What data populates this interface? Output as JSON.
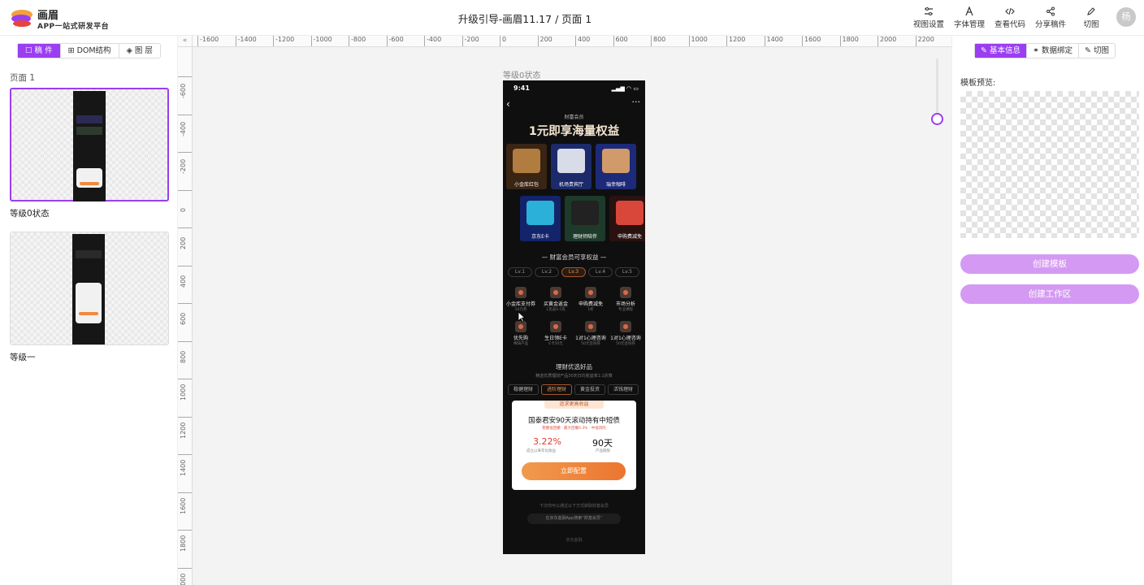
{
  "app": {
    "brand_name": "画眉",
    "brand_sub": "APP一站式研发平台",
    "doc_title": "升级引导-画眉11.17 / 页面 1",
    "avatar_text": "杨"
  },
  "toolbar": {
    "view_settings": "视图设置",
    "font_manage": "字体管理",
    "view_code": "查看代码",
    "share": "分享稿件",
    "slice": "切图"
  },
  "left_panel": {
    "tabs": [
      "稿 件",
      "DOM结构",
      "图 层"
    ],
    "active_tab": 0,
    "page_label": "页面 1",
    "frames": [
      {
        "name": "等级0状态",
        "selected": true
      },
      {
        "name": "等级一",
        "selected": false
      }
    ]
  },
  "canvas": {
    "ruler_h": [
      "-1600",
      "-1400",
      "-1200",
      "-1000",
      "-800",
      "-600",
      "-400",
      "-200",
      "0",
      "200",
      "400",
      "600",
      "800",
      "1000",
      "1200",
      "1400",
      "1600",
      "1800",
      "2000",
      "2200"
    ],
    "ruler_v": [
      "-600",
      "-400",
      "-200",
      "0",
      "200",
      "400",
      "600",
      "800",
      "1000",
      "1200",
      "1400",
      "1600",
      "1800",
      "2000"
    ],
    "frame_label": "等级0状态"
  },
  "phone": {
    "time": "9:41",
    "club_logo": "财富会员",
    "headline": "1元即享海量权益",
    "row1": [
      {
        "label": "小金库红包",
        "color": "#3a2414",
        "pic": "#b07c40"
      },
      {
        "label": "机场贵宾厅",
        "color": "#1c2a6b",
        "pic": "#d8dce8"
      },
      {
        "label": "瑞幸咖啡",
        "color": "#1d2a7a",
        "pic": "#d19a6b"
      }
    ],
    "row2": [
      {
        "label": "京东E卡",
        "color": "#13246b",
        "pic": "#2bb1d9"
      },
      {
        "label": "理财师陪伴",
        "color": "#1d3a2a",
        "pic": "#222"
      },
      {
        "label": "申购费减免",
        "color": "#2a1210",
        "pic": "#d8473a"
      }
    ],
    "benefits_title": "财富会员可享权益",
    "levels": [
      "Lv.1",
      "Lv.2",
      "Lv.3",
      "Lv.4",
      "Lv.5"
    ],
    "active_level": 2,
    "benefits": [
      {
        "name": "小金库支付券",
        "sub": "10元券"
      },
      {
        "name": "买黄金返金",
        "sub": "1克返0.5克"
      },
      {
        "name": "申购费减免",
        "sub": "1折"
      },
      {
        "name": "市场分析",
        "sub": "专业课程"
      },
      {
        "name": "优先购",
        "sub": "稀缺产品"
      },
      {
        "name": "生日领E卡",
        "sub": "E卡50元"
      },
      {
        "name": "1对1心理咨询",
        "sub": "50元咨询券"
      },
      {
        "name": "1对1心理咨询",
        "sub": "50元咨询券"
      }
    ],
    "picks_title": "理财优选好品",
    "picks_sub": "精选优质理财产品30天日均收益率1:1折算",
    "filters": [
      "稳健理财",
      "进阶理财",
      "黄金投资",
      "活钱理财"
    ],
    "active_filter": 1,
    "card": {
      "pill": "追求更高收益",
      "title": "国泰君安90天滚动持有中短债",
      "tags": "稳健低回撤 · 最大回撤0.3% · 中低风险",
      "rate": "3.22%",
      "rate_label": "成立以来年化收益",
      "days": "90天",
      "days_label": "产品期限",
      "cta": "立即配置"
    },
    "foot_note": "下次你可以通过以下方式获取财富会员",
    "foot_pill": "在京东金融App搜索“财富会员”",
    "foot_brand": "京东金融"
  },
  "right_panel": {
    "tabs": [
      "基本信息",
      "数据绑定",
      "切图"
    ],
    "active_tab": 0,
    "preview_label": "模板预览:",
    "create_template": "创建模板",
    "create_workspace": "创建工作区"
  }
}
